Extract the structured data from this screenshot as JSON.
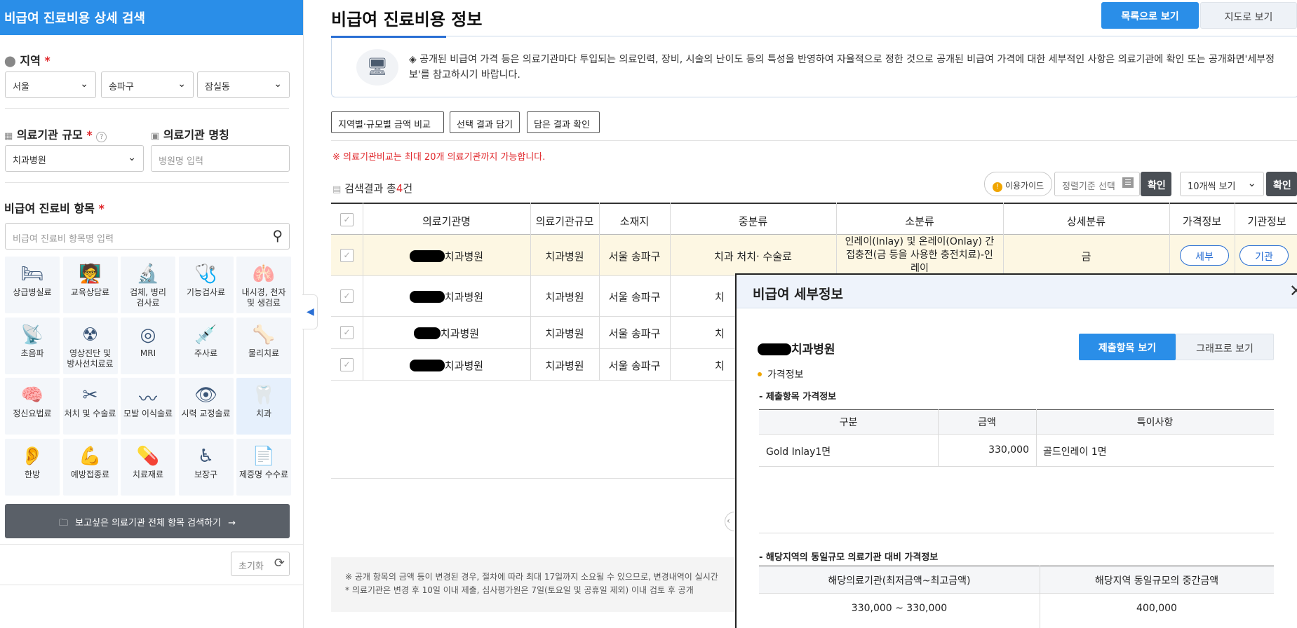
{
  "sidebar": {
    "title": "비급여 진료비용 상세 검색",
    "region": {
      "title": "지역",
      "required_mark": "*",
      "sido": "서울",
      "sigungu": "송파구",
      "dong": "잠실동"
    },
    "scale": {
      "title": "의료기관 규모",
      "required_mark": "*",
      "help_icon": "?",
      "value": "치과병원"
    },
    "name": {
      "title": "의료기관 명칭",
      "placeholder": "병원명 입력"
    },
    "items": {
      "title": "비급여 진료비 항목",
      "required_mark": "*",
      "search_placeholder": "비급여 진료비 항목명 입력",
      "categories": [
        {
          "label": "상급병실료",
          "icon": "hospital-bed-icon",
          "glyph": "🛏"
        },
        {
          "label": "교육상담료",
          "icon": "consultation-icon",
          "glyph": "🧑‍🏫"
        },
        {
          "label": "검체, 병리\n검사료",
          "icon": "microscope-icon",
          "glyph": "🔬"
        },
        {
          "label": "기능검사료",
          "icon": "function-test-icon",
          "glyph": "🩺"
        },
        {
          "label": "내시경, 천자\n및 생검료",
          "icon": "endoscope-icon",
          "glyph": "🫁"
        },
        {
          "label": "초음파",
          "icon": "ultrasound-icon",
          "glyph": "📡"
        },
        {
          "label": "영상진단 및\n방사선치료료",
          "icon": "radiology-icon",
          "glyph": "☢"
        },
        {
          "label": "MRI",
          "icon": "mri-icon",
          "glyph": "◎"
        },
        {
          "label": "주사료",
          "icon": "syringe-icon",
          "glyph": "💉"
        },
        {
          "label": "물리치료",
          "icon": "physical-therapy-icon",
          "glyph": "🦴"
        },
        {
          "label": "정신요법료",
          "icon": "brain-wave-icon",
          "glyph": "🧠"
        },
        {
          "label": "처치 및 수술료",
          "icon": "surgery-icon",
          "glyph": "✂"
        },
        {
          "label": "모발 이식술료",
          "icon": "hair-transplant-icon",
          "glyph": "〰"
        },
        {
          "label": "시력 교정술료",
          "icon": "eye-icon",
          "glyph": "👁"
        },
        {
          "label": "치과",
          "icon": "tooth-icon",
          "glyph": "🦷"
        },
        {
          "label": "한방",
          "icon": "oriental-medicine-icon",
          "glyph": "👂"
        },
        {
          "label": "예방접종료",
          "icon": "vaccine-icon",
          "glyph": "💪"
        },
        {
          "label": "치료재료",
          "icon": "treatment-material-icon",
          "glyph": "💊"
        },
        {
          "label": "보장구",
          "icon": "wheelchair-icon",
          "glyph": "♿"
        },
        {
          "label": "제증명 수수료",
          "icon": "certificate-icon",
          "glyph": "📄"
        }
      ]
    },
    "search_all_button": "보고싶은 의료기관 전체 항목 검색하기",
    "reset_button": "초기화"
  },
  "main": {
    "title": "비급여 진료비용 정보",
    "view_list": "목록으로 보기",
    "view_map": "지도로 보기",
    "notice": "◈ 공개된 비급여 가격 등은 의료기관마다 투입되는 의료인력, 장비, 시술의 난이도 등의 특성을 반영하여 자율적으로 정한 것으로 공개된 비급여 가격에 대한 세부적인 사항은 의료기관에 확인 또는 공개화면'세부정보'를 참고하시기 바랍니다.",
    "btn_compare": "지역별·규모별 금액 비교",
    "btn_add": "선택 결과 담기",
    "btn_check": "담은 결과 확인",
    "warning": "※ 의료기관비교는 최대 20개 의료기관까지 가능합니다.",
    "count_prefix": "검색결과 총",
    "count_num": "4",
    "count_suffix": "건",
    "guide": "이용가이드",
    "sort_placeholder": "정렬기준 선택",
    "confirm": "확인",
    "page_size": "10개씩 보기",
    "confirm2": "확인",
    "columns": [
      "의료기관명",
      "의료기관규모",
      "소재지",
      "중분류",
      "소분류",
      "상세분류",
      "가격정보",
      "기관정보"
    ],
    "rows": [
      {
        "name": "치과병원",
        "scale": "치과병원",
        "location": "서울 송파구",
        "mid": "치과 처치· 수술료",
        "small": "인레이(Inlay) 및 온레이(Onlay) 간접충전(금 등을 사용한 충전치료)-인레이",
        "detail": "금",
        "price_btn": "세부",
        "org_btn": "기관"
      },
      {
        "name": "치과병원",
        "scale": "치과병원",
        "location": "서울 송파구",
        "mid": "치"
      },
      {
        "name": "치과병원",
        "scale": "치과병원",
        "location": "서울 송파구",
        "mid": "치"
      },
      {
        "name": "치과병원",
        "scale": "치과병원",
        "location": "서울 송파구",
        "mid": "치"
      }
    ],
    "footnote1": "※ 공개 항목의 금액 등이 변경된 경우, 절차에 따라 최대 17일까지 소요될 수 있으므로, 변경내역이 실시간",
    "footnote2": "* 의료기관은 변경 후 10일 이내 제출, 심사평가원은 7일(토요일 및 공휴일 제외) 이내 검토 후 공개"
  },
  "modal": {
    "title": "비급여 세부정보",
    "close": "✕",
    "hospital": "치과병원",
    "tab_submitted": "제출항목 보기",
    "tab_graph": "그래프로 보기",
    "section": "가격정보",
    "sub1": "- 제출항목 가격정보",
    "t1_headers": [
      "구분",
      "금액",
      "특이사항"
    ],
    "t1_row": {
      "item": "Gold Inlay1면",
      "amount": "330,000",
      "note": "골드인레이 1면"
    },
    "sub2": "- 해당지역의 동일규모 의료기관 대비 가격정보",
    "t2_headers": [
      "해당의료기관(최저금액~최고금액)",
      "해당지역 동일규모의 중간금액"
    ],
    "t2_row": {
      "range": "330,000 ~ 330,000",
      "median": "400,000"
    }
  },
  "colors": {
    "primary": "#2a8ee8",
    "accent": "#2a6fd4",
    "required": "#e0262a",
    "highlight_row": "#fdf7e3"
  }
}
